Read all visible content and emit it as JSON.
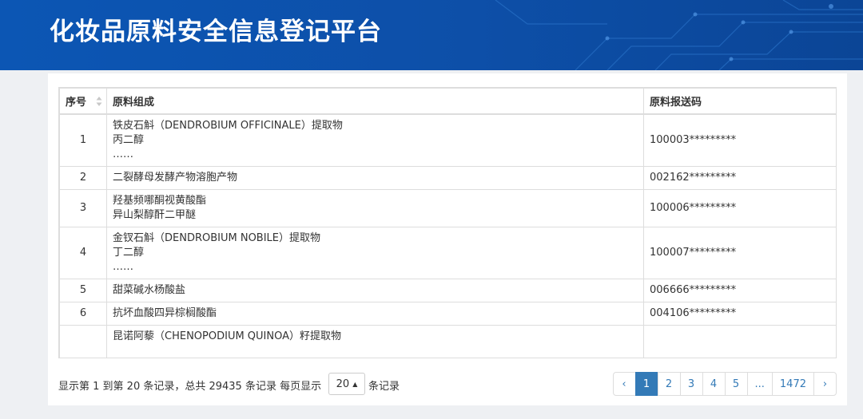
{
  "header": {
    "title": "化妆品原料安全信息登记平台"
  },
  "table": {
    "columns": [
      "序号",
      "原料组成",
      "原料报送码"
    ],
    "rows": [
      {
        "no": "1",
        "lines": [
          "铁皮石斛（DENDROBIUM OFFICINALE）提取物",
          "丙二醇",
          "……"
        ],
        "code": "100003*********"
      },
      {
        "no": "2",
        "lines": [
          "二裂酵母发酵产物溶胞产物"
        ],
        "code": "002162*********"
      },
      {
        "no": "3",
        "lines": [
          "羟基频哪酮视黄酸酯",
          "异山梨醇酐二甲醚"
        ],
        "code": "100006*********"
      },
      {
        "no": "4",
        "lines": [
          "金钗石斛（DENDROBIUM NOBILE）提取物",
          "丁二醇",
          "……"
        ],
        "code": "100007*********"
      },
      {
        "no": "5",
        "lines": [
          "甜菜碱水杨酸盐"
        ],
        "code": "006666*********"
      },
      {
        "no": "6",
        "lines": [
          "抗坏血酸四异棕榈酸酯"
        ],
        "code": "004106*********"
      },
      {
        "no": "",
        "lines": [
          "昆诺阿藜（CHENOPODIUM QUINOA）籽提取物",
          ""
        ],
        "code": ""
      }
    ]
  },
  "footer": {
    "summary": "显示第 1 到第 20 条记录，总共 29435 条记录  每页显示",
    "page_size": "20",
    "per_page_suffix": "条记录",
    "pages": [
      "‹",
      "1",
      "2",
      "3",
      "4",
      "5",
      "...",
      "1472",
      "›"
    ],
    "active_page": "1"
  },
  "colors": {
    "header_blue": "#0c56b4",
    "accent": "#337ab7",
    "border": "#dddddd",
    "background": "#eef0f3"
  }
}
